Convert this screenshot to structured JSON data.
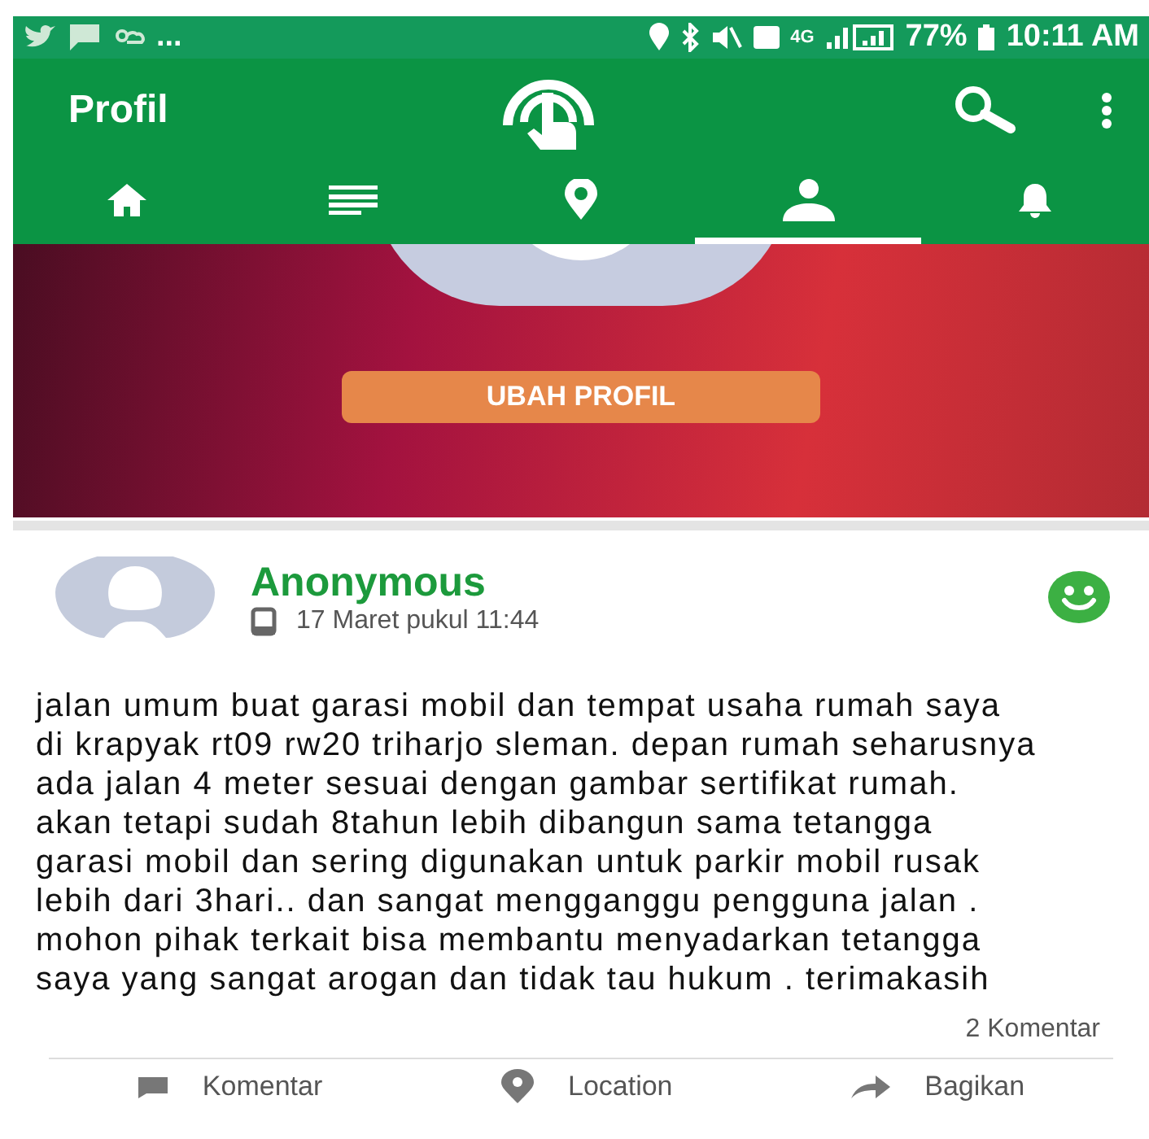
{
  "status_bar": {
    "overflow": "...",
    "network": "4G",
    "battery": "77%",
    "time": "10:11 AM"
  },
  "app_bar": {
    "title": "Profil"
  },
  "tabs": [
    {
      "kind": "home",
      "selected": false
    },
    {
      "kind": "list",
      "selected": false
    },
    {
      "kind": "pin",
      "selected": false
    },
    {
      "kind": "person",
      "selected": true
    },
    {
      "kind": "bell",
      "selected": false
    }
  ],
  "profile": {
    "edit_button": "UBAH PROFIL"
  },
  "post": {
    "author": "Anonymous",
    "time": "17 Maret pukul 11:44",
    "body": "jalan umum buat garasi mobil dan tempat usaha rumah saya di krapyak rt09 rw20 triharjo sleman. depan rumah seharusnya ada jalan 4 meter sesuai dengan gambar sertifikat rumah. akan tetapi sudah 8tahun lebih dibangun sama tetangga garasi mobil dan sering digunakan untuk parkir mobil rusak lebih dari 3hari.. dan sangat mengganggu pengguna jalan . mohon pihak terkait bisa membantu menyadarkan tetangga saya yang sangat arogan dan tidak tau hukum . terimakasih",
    "comment_count": "2 Komentar",
    "actions": [
      {
        "kind": "comment",
        "label": "Komentar"
      },
      {
        "kind": "location",
        "label": "Location"
      },
      {
        "kind": "share",
        "label": "Bagikan"
      }
    ]
  }
}
